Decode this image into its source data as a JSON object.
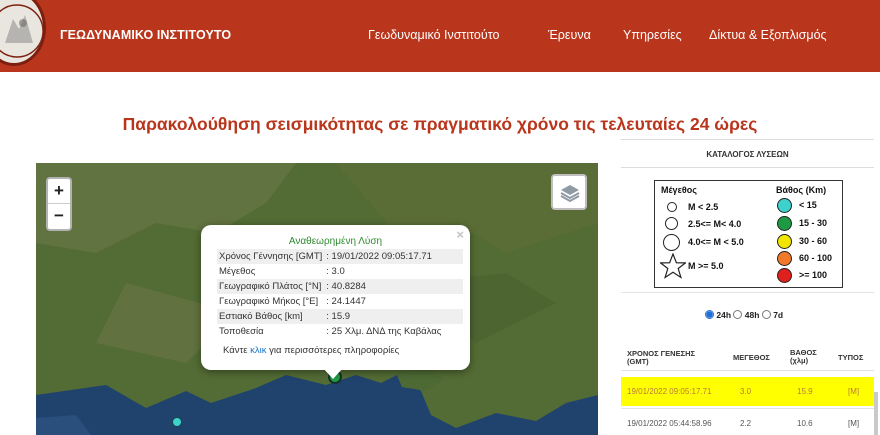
{
  "header": {
    "site_title": "ΓΕΩΔΥΝΑΜΙΚΟ ΙΝΣΤΙΤΟΥΤΟ",
    "nav": [
      "Γεωδυναμικό Ινστιτούτο",
      "Έρευνα",
      "Υπηρεσίες",
      "Δίκτυα & Εξοπλισμός"
    ]
  },
  "page_title": "Παρακολούθηση σεισμικότητας σε πραγματικό χρόνο τις τελευταίες 24 ώρες",
  "map": {
    "zoom_in": "+",
    "zoom_out": "−",
    "popup": {
      "close": "×",
      "heading": "Αναθεωρημένη Λύση",
      "rows": [
        {
          "key": "Χρόνος Γέννησης [GMT]",
          "value": ": 19/01/2022 09:05:17.71"
        },
        {
          "key": "Μέγεθος",
          "value": ": 3.0"
        },
        {
          "key": "Γεωγραφικό Πλάτος [°N]",
          "value": ": 40.8284"
        },
        {
          "key": "Γεωγραφικό Μήκος [°E]",
          "value": ": 24.1447"
        },
        {
          "key": "Εστιακό Βάθος [km]",
          "value": ": 15.9"
        },
        {
          "key": "Τοποθεσία",
          "value": ": 25 Χλμ. ΔΝΔ της Καβάλας"
        }
      ],
      "link_prefix": "Κάντε ",
      "link_text": "κλικ",
      "link_suffix": " για περισσότερες πληροφορίες"
    }
  },
  "catalog": {
    "title": "ΚΑΤΑΛΟΓΟΣ ΛΥΣΕΩΝ",
    "legend": {
      "magnitude_title": "Μέγεθος",
      "depth_title": "Βάθος (Km)",
      "magnitudes": [
        "M < 2.5",
        "2.5<= M< 4.0",
        "4.0<= M < 5.0",
        "M >= 5.0"
      ],
      "depths": [
        {
          "label": "< 15",
          "color": "#3fd1cc"
        },
        {
          "label": "15 - 30",
          "color": "#1e9a44"
        },
        {
          "label": "30 - 60",
          "color": "#f2e600"
        },
        {
          "label": "60 - 100",
          "color": "#f07a2a"
        },
        {
          "label": ">= 100",
          "color": "#e0201c"
        }
      ]
    },
    "periods": [
      {
        "label": "24h",
        "selected": true
      },
      {
        "label": "48h",
        "selected": false
      },
      {
        "label": "7d",
        "selected": false
      }
    ],
    "columns": {
      "origin_time": "ΧΡΟΝΟΣ ΓΕΝΕΣΗΣ (GMT)",
      "magnitude": "ΜΕΓΕΘΟΣ",
      "depth": "ΒΑΘΟΣ (χλμ)",
      "type": "ΤΥΠΟΣ"
    },
    "rows": [
      {
        "time": "19/01/2022 09:05:17.71",
        "mag": "3.0",
        "depth": "15.9",
        "type": "[M]",
        "highlighted": true
      },
      {
        "time": "19/01/2022 05:44:58.96",
        "mag": "2.2",
        "depth": "10.6",
        "type": "[M]",
        "highlighted": false
      }
    ]
  }
}
